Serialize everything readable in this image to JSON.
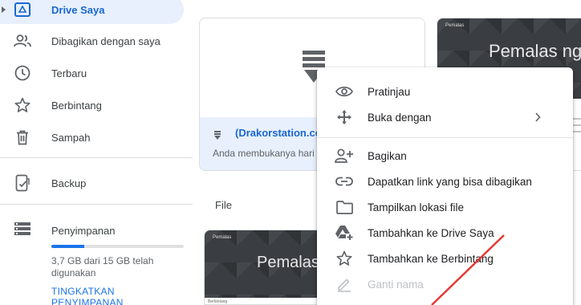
{
  "sidebar": {
    "items": [
      {
        "label": "Drive Saya",
        "icon": "drive-icon"
      },
      {
        "label": "Dibagikan dengan saya",
        "icon": "people-icon"
      },
      {
        "label": "Terbaru",
        "icon": "clock-icon"
      },
      {
        "label": "Berbintang",
        "icon": "star-icon"
      },
      {
        "label": "Sampah",
        "icon": "trash-icon"
      },
      {
        "label": "Backup",
        "icon": "backup-icon"
      }
    ],
    "storage": {
      "title": "Penyimpanan",
      "used_fraction": 0.247,
      "text": "3,7 GB dari 15 GB telah digunakan",
      "upgrade": "TINGKATKAN PENYIMPANAN"
    }
  },
  "main": {
    "card1": {
      "file_name": "(Drakorstation.co",
      "subtitle": "Anda membukanya hari"
    },
    "card2": {
      "slide_small": "Pemalas",
      "slide_big": "Pemalas ngel"
    },
    "section_file": "File",
    "card3": {
      "slide_small": "Pemalas",
      "slide_big": "Pemalas",
      "below_small": "Berbintang"
    }
  },
  "context_menu": {
    "items": [
      {
        "label": "Pratinjau",
        "icon": "eye-icon"
      },
      {
        "label": "Buka dengan",
        "icon": "move-icon"
      },
      {
        "label": "Bagikan",
        "icon": "person-add-icon"
      },
      {
        "label": "Dapatkan link yang bisa dibagikan",
        "icon": "link-icon"
      },
      {
        "label": "Tampilkan lokasi file",
        "icon": "folder-icon"
      },
      {
        "label": "Tambahkan ke Drive Saya",
        "icon": "drive-add-icon"
      },
      {
        "label": "Tambahkan ke Berbintang",
        "icon": "star-icon"
      },
      {
        "label": "Ganti nama",
        "icon": "pencil-icon"
      }
    ]
  },
  "colors": {
    "accent": "#1a73e8",
    "active_bg": "#e8f0fe",
    "annotation_arrow": "#e53935"
  }
}
